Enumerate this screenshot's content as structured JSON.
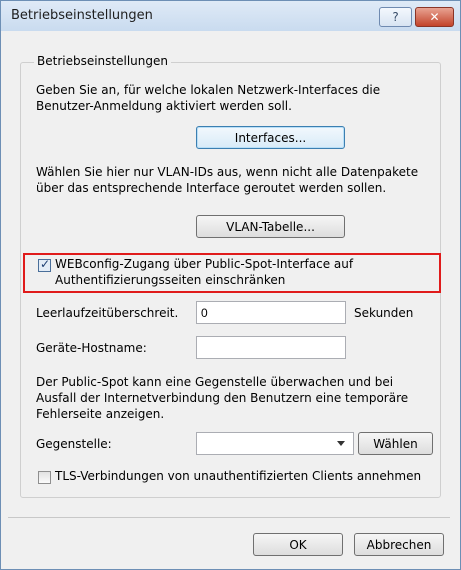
{
  "window": {
    "title": "Betriebseinstellungen",
    "help_label": "?",
    "close_label": "✕"
  },
  "group": {
    "legend": "Betriebseinstellungen",
    "intro_line1": "Geben Sie an, für welche lokalen Netzwerk-Interfaces die",
    "intro_line2": "Benutzer-Anmeldung aktiviert werden soll.",
    "interfaces_button": "Interfaces...",
    "vlan_line1": "Wählen Sie hier nur VLAN-IDs aus, wenn nicht alle Datenpakete",
    "vlan_line2": "über das entsprechende Interface geroutet werden sollen.",
    "vlan_button": "VLAN-Tabelle...",
    "webconfig_checkbox": {
      "checked": true,
      "label_line1": "WEBconfig-Zugang über Public-Spot-Interface auf",
      "label_line2": "Authentifizierungsseiten einschränken"
    },
    "idle_label": "Leerlaufzeitüberschreit.",
    "idle_value": "0",
    "idle_unit": "Sekunden",
    "hostname_label": "Geräte-Hostname:",
    "hostname_value": "",
    "monitor_line1": "Der Public-Spot kann eine Gegenstelle überwachen und bei",
    "monitor_line2": "Ausfall der Internetverbindung den Benutzern eine temporäre",
    "monitor_line3": "Fehlerseite anzeigen.",
    "remote_label": "Gegenstelle:",
    "remote_value": "",
    "choose_button": "Wählen",
    "tls_checkbox": {
      "checked": false,
      "label": "TLS-Verbindungen von unauthentifizierten Clients annehmen"
    }
  },
  "footer": {
    "ok_button": "OK",
    "cancel_button": "Abbrechen"
  }
}
